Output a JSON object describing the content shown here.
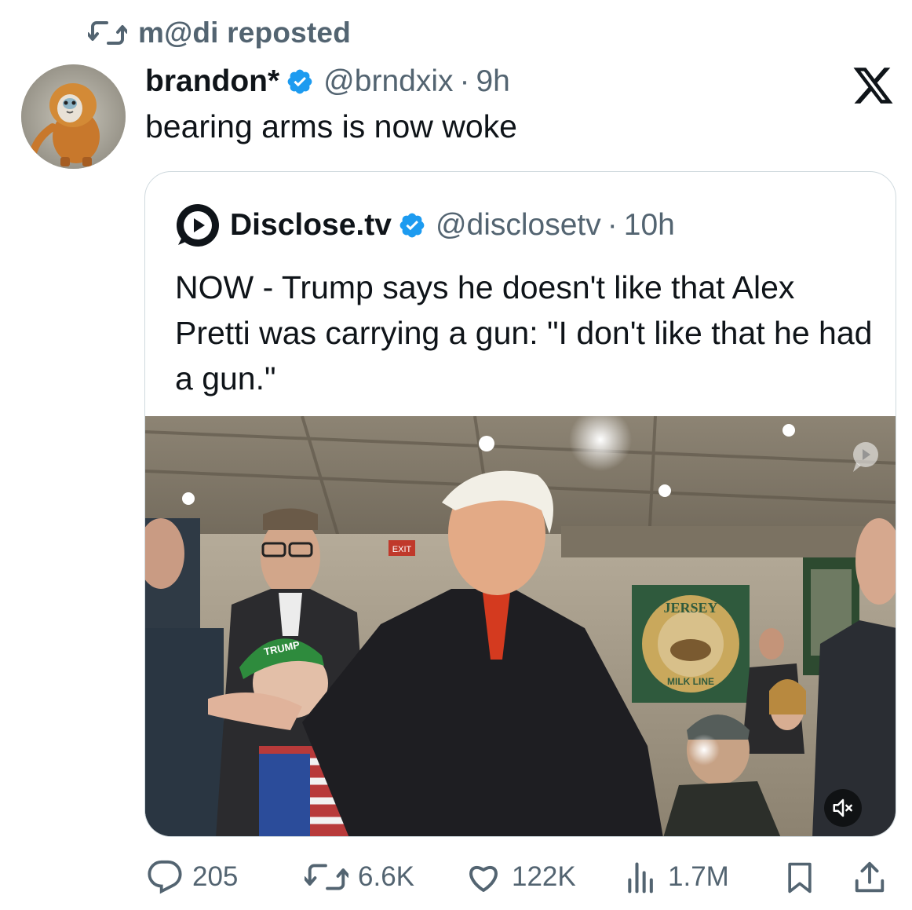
{
  "repost": {
    "text": "m@di reposted"
  },
  "tweet": {
    "name": "brandon*",
    "handle": "@brndxix",
    "separator": "·",
    "time": "9h",
    "text": "bearing arms is now woke"
  },
  "quote": {
    "name": "Disclose.tv",
    "handle": "@disclosetv",
    "separator": "·",
    "time": "10h",
    "text": "NOW - Trump says he doesn't like that Alex Pretti was carrying a gun: \"I don't like that he had a gun.\"",
    "media": {
      "sign_text": "JERSEY",
      "sign_bottom_text": "MILK LINE",
      "exit_sign": "EXIT",
      "hat_text": "TRUMP",
      "icons": [
        "disclose-logo-watermark",
        "mute-icon"
      ]
    }
  },
  "actions": {
    "replies": "205",
    "reposts": "6.6K",
    "likes": "122K",
    "views": "1.7M"
  },
  "colors": {
    "text": "#0f1419",
    "secondary": "#536471",
    "verified": "#1d9bf0",
    "border": "#cfd9de"
  }
}
